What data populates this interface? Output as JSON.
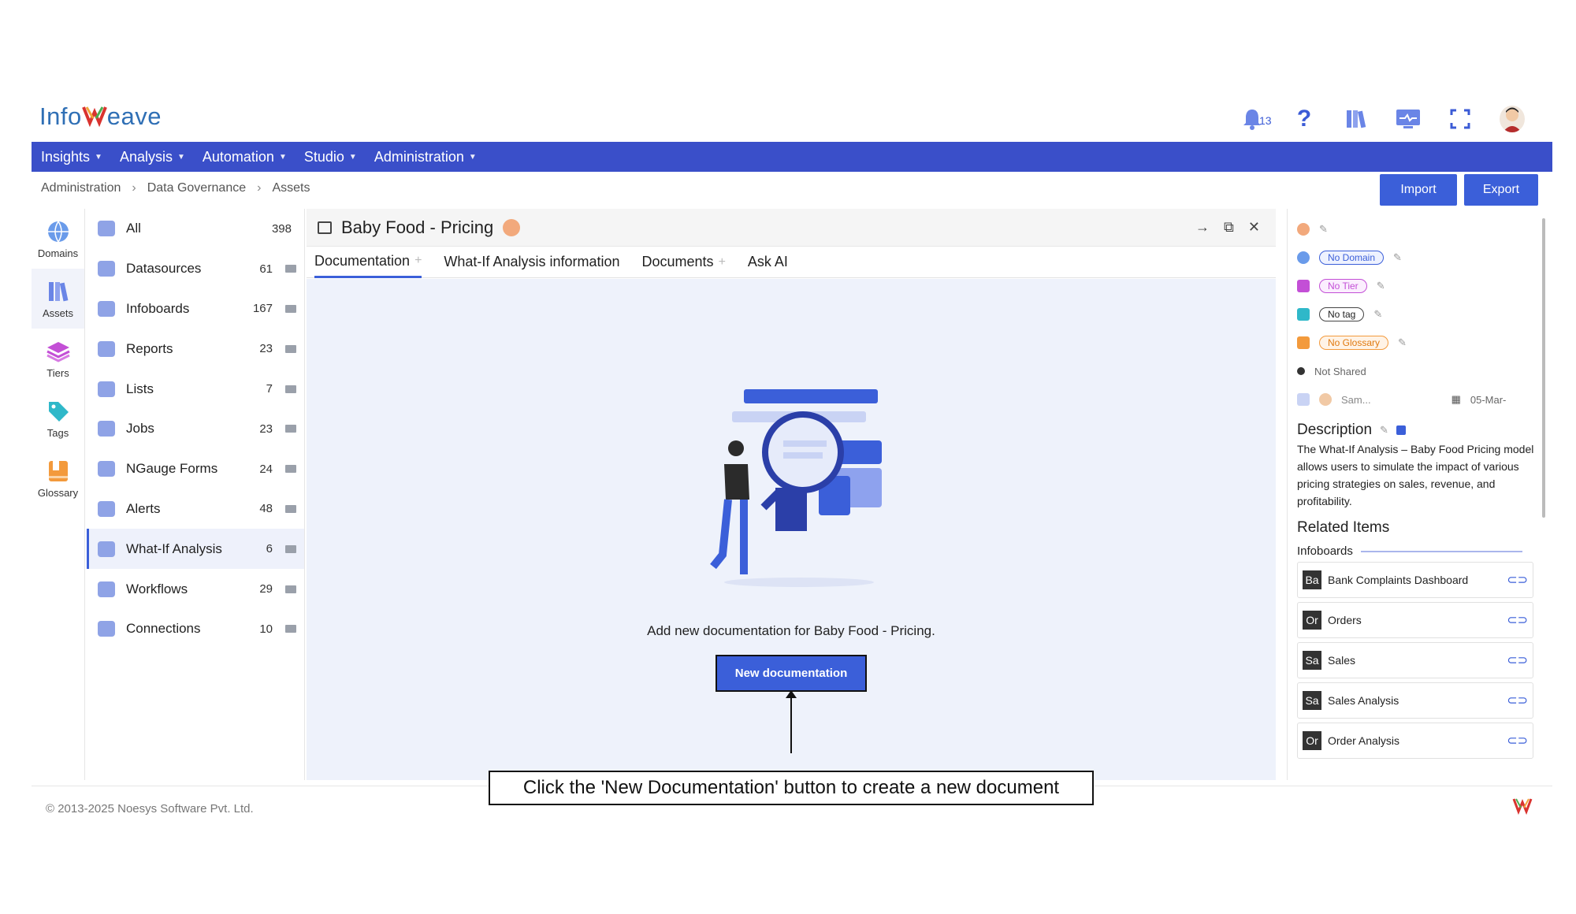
{
  "app": {
    "logo": "InfoWeave"
  },
  "header": {
    "notification_count": "13"
  },
  "nav": [
    {
      "label": "Insights"
    },
    {
      "label": "Analysis"
    },
    {
      "label": "Automation"
    },
    {
      "label": "Studio"
    },
    {
      "label": "Administration"
    }
  ],
  "breadcrumb": [
    "Administration",
    "Data Governance",
    "Assets"
  ],
  "actions": {
    "import": "Import",
    "export": "Export"
  },
  "rail": [
    {
      "label": "Domains"
    },
    {
      "label": "Assets"
    },
    {
      "label": "Tiers"
    },
    {
      "label": "Tags"
    },
    {
      "label": "Glossary"
    }
  ],
  "list": [
    {
      "label": "All",
      "count": "398"
    },
    {
      "label": "Datasources",
      "count": "61"
    },
    {
      "label": "Infoboards",
      "count": "167"
    },
    {
      "label": "Reports",
      "count": "23"
    },
    {
      "label": "Lists",
      "count": "7"
    },
    {
      "label": "Jobs",
      "count": "23"
    },
    {
      "label": "NGauge Forms",
      "count": "24"
    },
    {
      "label": "Alerts",
      "count": "48"
    },
    {
      "label": "What-If Analysis",
      "count": "6"
    },
    {
      "label": "Workflows",
      "count": "29"
    },
    {
      "label": "Connections",
      "count": "10"
    }
  ],
  "asset": {
    "title": "Baby Food - Pricing",
    "tabs": [
      "Documentation",
      "What-If Analysis information",
      "Documents",
      "Ask AI"
    ],
    "empty_text": "Add new documentation for Baby Food - Pricing.",
    "new_button": "New documentation"
  },
  "callout": "Click the 'New Documentation' button to create a new document",
  "details": {
    "domain": "No Domain",
    "tier": "No Tier",
    "tag": "No tag",
    "glossary": "No Glossary",
    "shared": "Not Shared",
    "owner": "Sam...",
    "date": "05-Mar-",
    "description_title": "Description",
    "description": "The What-If Analysis – Baby Food Pricing model allows users to simulate the impact of various pricing strategies on sales, revenue, and profitability.",
    "related_title": "Related Items",
    "related_section": "Infoboards",
    "related": [
      {
        "abbr": "Ba",
        "name": "Bank Complaints Dashboard"
      },
      {
        "abbr": "Or",
        "name": "Orders"
      },
      {
        "abbr": "Sa",
        "name": "Sales"
      },
      {
        "abbr": "Sa",
        "name": "Sales Analysis"
      },
      {
        "abbr": "Or",
        "name": "Order Analysis"
      }
    ]
  },
  "footer": {
    "copyright": "© 2013-2025 Noesys Software Pvt. Ltd."
  },
  "colors": {
    "primary": "#3a4fc9",
    "button": "#3b5fd9",
    "canvas": "#eef2fb"
  }
}
